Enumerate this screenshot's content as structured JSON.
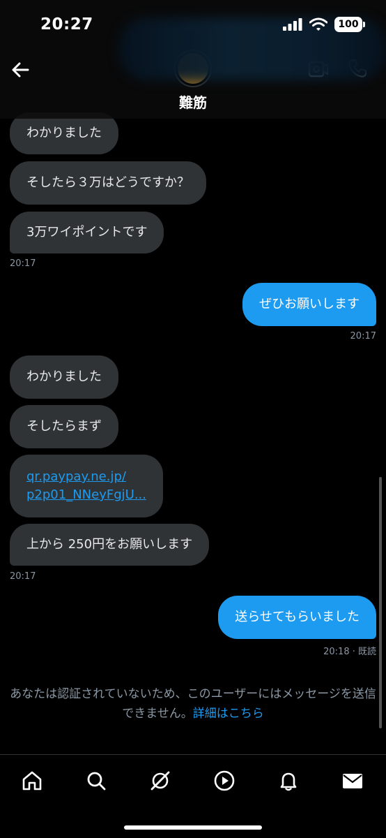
{
  "status_bar": {
    "time": "20:27",
    "battery": "100"
  },
  "header": {
    "name": "難筋"
  },
  "messages": [
    {
      "text": "わかりました"
    },
    {
      "text": "そしたら３万はどうですか？"
    },
    {
      "text": "3万ワイポイントです"
    },
    {
      "time": "20:17"
    },
    {
      "text": "ぜひお願いします"
    },
    {
      "time": "20:17"
    },
    {
      "text": "わかりました"
    },
    {
      "text": "そしたらまず"
    },
    {
      "line1": "qr.paypay.ne.jp/",
      "line2": "p2p01_NNeyFgjU..."
    },
    {
      "text": "上から 250円をお願いします"
    },
    {
      "time": "20:17"
    },
    {
      "text": "送らせてもらいました"
    },
    {
      "time": "20:18 · 既読"
    }
  ],
  "notice": {
    "text": "あなたは認証されていないため、このユーザーにはメッセージを送信できません。",
    "link": "詳細はこちら"
  },
  "nav": [
    "home",
    "search",
    "grok",
    "media",
    "notifications",
    "messages"
  ],
  "colors": {
    "accent": "#1d9bf0",
    "incoming_bubble": "#2f3336",
    "background": "#000000"
  }
}
